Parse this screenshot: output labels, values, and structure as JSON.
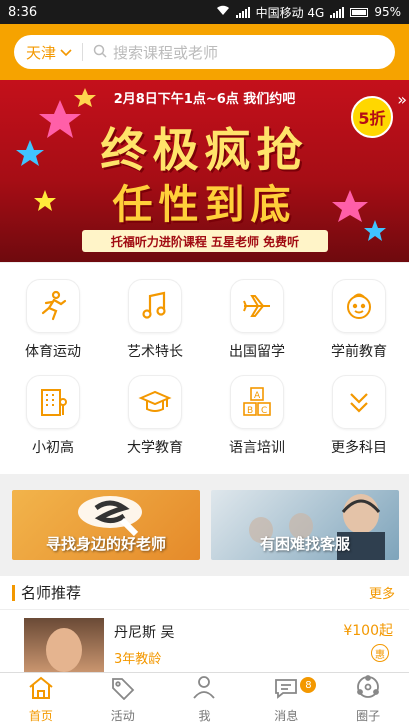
{
  "status": {
    "time": "8:36",
    "carrier": "中国移动 4G",
    "battery": "95%"
  },
  "search": {
    "city": "天津",
    "placeholder": "搜索课程或老师"
  },
  "banner": {
    "top_line": "2月8日下午1点~6点 我们约吧",
    "title_line1": "终极疯抢",
    "title_line2": "任性到底",
    "strip": "托福听力进阶课程 五星老师 免费听",
    "badge": "5折"
  },
  "categories": [
    {
      "label": "体育运动",
      "icon": "runner-icon"
    },
    {
      "label": "艺术特长",
      "icon": "music-note-icon"
    },
    {
      "label": "出国留学",
      "icon": "airplane-icon"
    },
    {
      "label": "学前教育",
      "icon": "baby-face-icon"
    },
    {
      "label": "小初高",
      "icon": "school-building-icon"
    },
    {
      "label": "大学教育",
      "icon": "graduation-cap-icon"
    },
    {
      "label": "语言培训",
      "icon": "abc-blocks-icon"
    },
    {
      "label": "更多科目",
      "icon": "chevron-double-down-icon"
    }
  ],
  "promos": [
    {
      "label": "寻找身边的好老师"
    },
    {
      "label": "有困难找客服"
    }
  ],
  "teachers": {
    "title": "名师推荐",
    "more": "更多",
    "items": [
      {
        "name": "丹尼斯 吴",
        "years": "3年教龄",
        "price": "¥100起",
        "badge": "惠"
      }
    ]
  },
  "tabs": [
    {
      "label": "首页",
      "icon": "home-icon",
      "active": true
    },
    {
      "label": "活动",
      "icon": "tag-icon"
    },
    {
      "label": "我",
      "icon": "user-icon"
    },
    {
      "label": "消息",
      "icon": "chat-bubble-icon",
      "badge": "8"
    },
    {
      "label": "圈子",
      "icon": "circle-network-icon"
    }
  ],
  "colors": {
    "accent": "#f39800",
    "banner_red": "#c4101b"
  }
}
